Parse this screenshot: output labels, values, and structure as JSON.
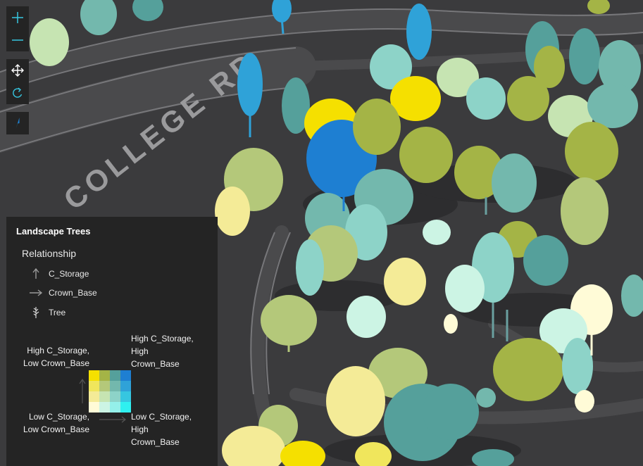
{
  "toolbar": {
    "zoom_in_icon": "plus-icon",
    "zoom_out_icon": "minus-icon",
    "pan_icon": "move-arrows-icon",
    "rotate_icon": "rotate-icon",
    "compass_icon": "compass-icon"
  },
  "map": {
    "road_label": "COLLEGE RD"
  },
  "legend": {
    "title": "Landscape Trees",
    "subtitle": "Relationship",
    "items": [
      {
        "label": "C_Storage",
        "icon": "arrow-up-icon"
      },
      {
        "label": "Crown_Base",
        "icon": "arrow-right-icon"
      },
      {
        "label": "Tree",
        "icon": "tree-icon"
      }
    ],
    "corners": {
      "top_left": [
        "High C_Storage,",
        "Low Crown_Base"
      ],
      "top_right": [
        "High C_Storage,",
        "High",
        "Crown_Base"
      ],
      "bottom_left": [
        "Low C_Storage,",
        "Low Crown_Base"
      ],
      "bottom_right": [
        "Low C_Storage,",
        "High",
        "Crown_Base"
      ]
    },
    "grid_colors": [
      [
        "#f5e000",
        "#a4b446",
        "#55a09b",
        "#1e7fd2"
      ],
      [
        "#f0e65c",
        "#b4c87a",
        "#73b8ad",
        "#2fa2d8"
      ],
      [
        "#f4eb97",
        "#c6e4b2",
        "#8dd3c8",
        "#36c6e0"
      ],
      [
        "#fffbd7",
        "#ccf4e4",
        "#94f0ea",
        "#2ff0f0"
      ]
    ]
  },
  "colors": {
    "panel_bg": "#242424",
    "ground": "#3c3c3e",
    "road": "#4c4c4e"
  }
}
